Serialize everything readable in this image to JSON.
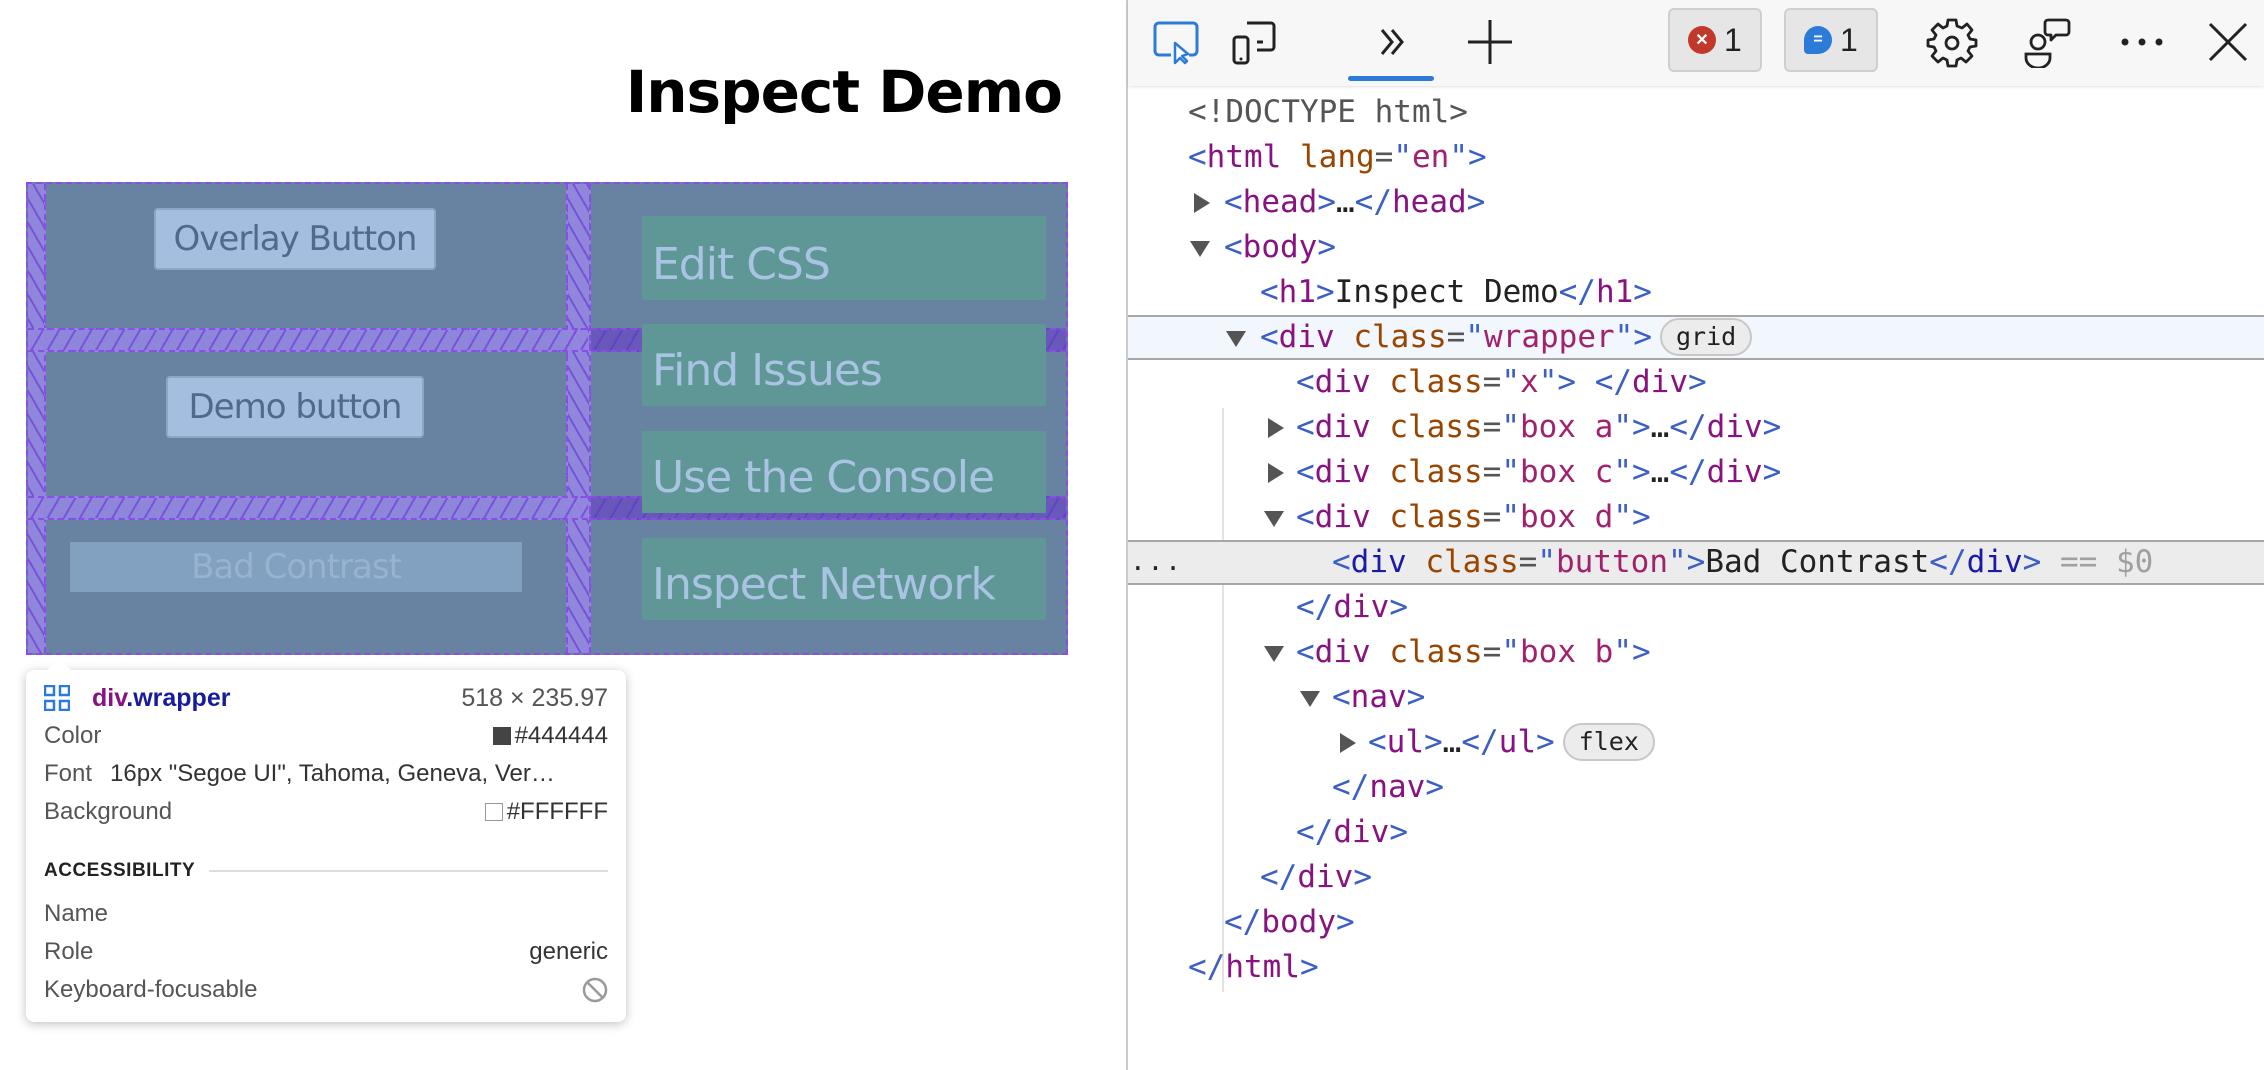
{
  "page": {
    "heading": "Inspect Demo",
    "buttons": {
      "overlay": "Overlay Button",
      "demo": "Demo button",
      "bad_contrast": "Bad Contrast"
    },
    "nav_items": [
      "Edit CSS",
      "Find Issues",
      "Use the Console",
      "Inspect Network"
    ]
  },
  "tooltip": {
    "icon": "grid-icon",
    "element_tag": "div",
    "element_class": ".wrapper",
    "dimensions": "518 × 235.97",
    "rows": [
      {
        "label": "Color",
        "value": "#444444",
        "swatch": "#444444"
      },
      {
        "label": "Font",
        "value": "16px \"Segoe UI\", Tahoma, Geneva, Ver…"
      },
      {
        "label": "Background",
        "value": "#FFFFFF",
        "swatch": "#FFFFFF"
      }
    ],
    "accessibility": {
      "section_title": "ACCESSIBILITY",
      "name_label": "Name",
      "name_value": "",
      "role_label": "Role",
      "role_value": "generic",
      "focusable_label": "Keyboard-focusable",
      "focusable_icon": "not-allowed-icon"
    }
  },
  "devtools": {
    "toolbar": {
      "icons": [
        "inspect-element-icon",
        "device-emulation-icon",
        "more-tools-chevron-icon",
        "add-tab-icon"
      ],
      "errors_count": "1",
      "issues_count": "1",
      "right_icons": [
        "settings-icon",
        "feedback-icon",
        "more-options-icon",
        "close-icon"
      ]
    },
    "dom": {
      "doctype": "<!DOCTYPE html>",
      "html_lang_attr": "lang",
      "html_lang_value": "en",
      "head_tag": "head",
      "body_tag": "body",
      "h1_text": "Inspect Demo",
      "wrapper_class": "wrapper",
      "wrapper_badge": "grid",
      "x_class": "x",
      "box_a_class": "box a",
      "box_c_class": "box c",
      "box_d_class": "box d",
      "button_class": "button",
      "button_text": "Bad Contrast",
      "selected_marker": "== $0",
      "gutter_ellipsis": "...",
      "box_b_class": "box b",
      "nav_tag": "nav",
      "ul_tag": "ul",
      "ul_badge": "flex",
      "collapsed_ellipsis": "…"
    }
  }
}
